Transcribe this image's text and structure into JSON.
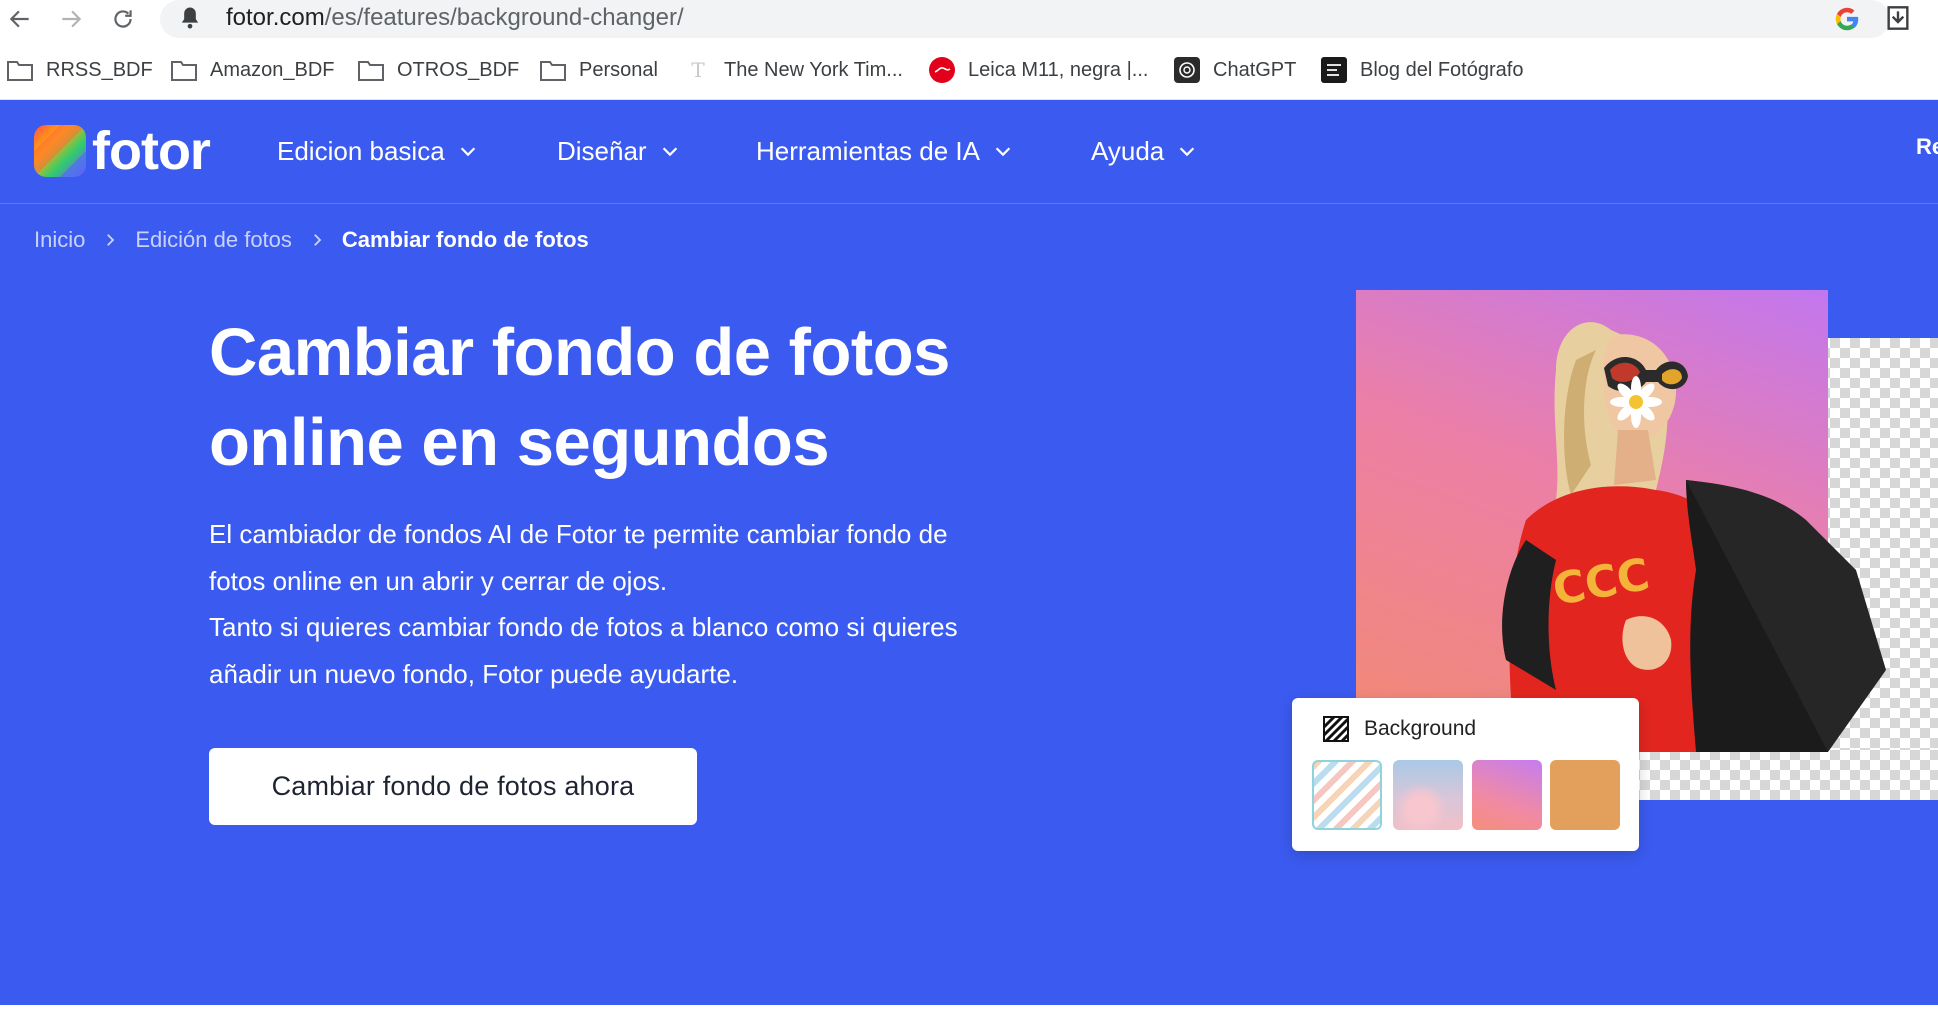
{
  "browser": {
    "url_host": "fotor.com",
    "url_path": "/es/features/background-changer/",
    "bookmarks": [
      {
        "label": "RRSS_BDF",
        "icon": "folder-icon"
      },
      {
        "label": "Amazon_BDF",
        "icon": "folder-icon"
      },
      {
        "label": "OTROS_BDF",
        "icon": "folder-icon"
      },
      {
        "label": "Personal",
        "icon": "folder-icon"
      },
      {
        "label": "The New York Tim...",
        "icon": "nyt-icon"
      },
      {
        "label": "Leica M11, negra |...",
        "icon": "leica-icon"
      },
      {
        "label": "ChatGPT",
        "icon": "chatgpt-icon"
      },
      {
        "label": "Blog del Fotógrafo",
        "icon": "blog-icon"
      }
    ]
  },
  "site": {
    "logo_text": "fotor",
    "nav": [
      {
        "label": "Edicion basica"
      },
      {
        "label": "Diseñar"
      },
      {
        "label": "Herramientas de IA"
      },
      {
        "label": "Ayuda"
      }
    ],
    "header_cut_text": "Re",
    "breadcrumb": [
      "Inicio",
      "Edición de fotos",
      "Cambiar fondo de fotos"
    ],
    "hero": {
      "title_line1": "Cambiar fondo de fotos",
      "title_line2": "online en segundos",
      "desc_line1": "El cambiador de fondos AI de Fotor te permite cambiar fondo de",
      "desc_line2": "fotos online en un abrir y cerrar de ojos.",
      "desc_line3": "Tanto si quieres cambiar fondo de fotos a blanco como si quieres",
      "desc_line4": "añadir un nuevo fondo, Fotor puede ayudarte.",
      "cta_label": "Cambiar fondo de fotos ahora"
    },
    "background_panel": {
      "title": "Background",
      "swatches": [
        "pastel-stripes",
        "sky-clouds",
        "pink-gradient",
        "orange"
      ]
    }
  },
  "colors": {
    "brand_blue": "#3b5bf0",
    "cta_text": "#1f2433"
  }
}
